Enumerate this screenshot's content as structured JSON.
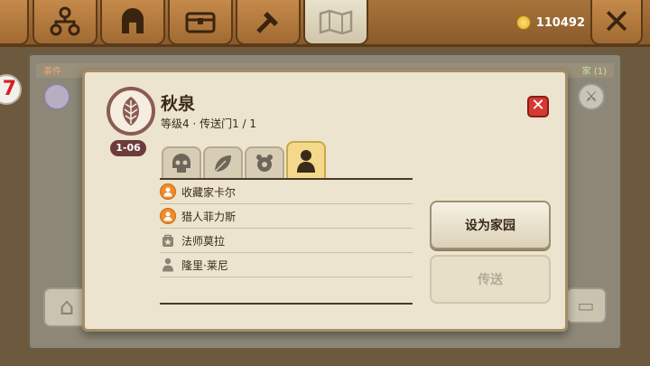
{
  "topbar": {
    "tabs": [
      {
        "name": "structure-icon"
      },
      {
        "name": "helmet-icon"
      },
      {
        "name": "chest-icon"
      },
      {
        "name": "hammer-icon"
      },
      {
        "name": "map-icon"
      }
    ],
    "gold": "110492",
    "close_label": "✕"
  },
  "background": {
    "strip_left": "事件",
    "strip_right": "家 (1)",
    "badge_text": "7"
  },
  "dialog": {
    "title": "秋泉",
    "subtitle": "等级4 · 传送门1 / 1",
    "level_badge": "1-06",
    "close_label": "✕",
    "filter_tabs": [
      {
        "name": "skull-icon"
      },
      {
        "name": "leaf-icon"
      },
      {
        "name": "creature-icon"
      },
      {
        "name": "person-icon",
        "active": true
      }
    ],
    "npcs": [
      {
        "name": "收藏家卡尔",
        "icon": "orange-person-icon"
      },
      {
        "name": "猎人菲力斯",
        "icon": "orange-person-icon"
      },
      {
        "name": "法师莫拉",
        "icon": "star-bag-icon"
      },
      {
        "name": "隆里·莱尼",
        "icon": "gray-person-icon"
      }
    ],
    "set_home_label": "设为家园",
    "teleport_label": "传送"
  },
  "colors": {
    "accent_orange": "#f08b2a",
    "close_red": "#d23a32",
    "badge_maroon": "#6e3b3b"
  }
}
